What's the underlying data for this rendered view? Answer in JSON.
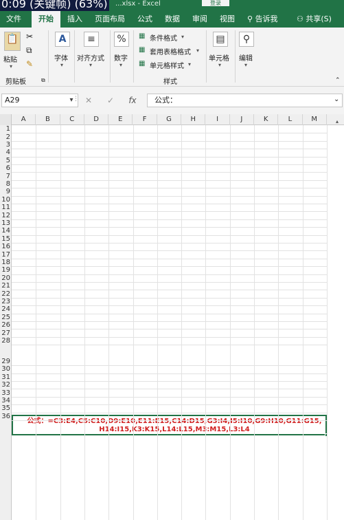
{
  "overlay": {
    "text": "0:09 (关键帧) (63%)"
  },
  "window": {
    "title_fragment": "...xlsx - Excel",
    "title_button": "登录"
  },
  "tabs": [
    {
      "label": "文件",
      "active": false
    },
    {
      "label": "开始",
      "active": true
    },
    {
      "label": "插入",
      "active": false
    },
    {
      "label": "页面布局",
      "active": false
    },
    {
      "label": "公式",
      "active": false
    },
    {
      "label": "数据",
      "active": false
    },
    {
      "label": "审阅",
      "active": false
    },
    {
      "label": "视图",
      "active": false
    }
  ],
  "tell_me": "告诉我",
  "share": "共享(S)",
  "ribbon": {
    "clipboard": {
      "paste": "粘贴",
      "group": "剪贴板"
    },
    "font": "字体",
    "alignment": "对齐方式",
    "number": "数字",
    "styles": {
      "conditional": "条件格式",
      "table": "套用表格格式",
      "cell_styles": "单元格样式",
      "group": "样式"
    },
    "cells": "单元格",
    "editing": "编辑"
  },
  "formula_bar": {
    "name_box": "A29",
    "cancel": "✕",
    "confirm": "✓",
    "fx": "fx",
    "content": "公式："
  },
  "columns": [
    "A",
    "B",
    "C",
    "D",
    "E",
    "F",
    "G",
    "H",
    "I",
    "J",
    "K",
    "L",
    "M"
  ],
  "rows": [
    "1",
    "2",
    "3",
    "4",
    "5",
    "6",
    "7",
    "8",
    "9",
    "10",
    "11",
    "12",
    "13",
    "14",
    "15",
    "16",
    "17",
    "18",
    "19",
    "20",
    "21",
    "22",
    "23",
    "24",
    "25",
    "26",
    "27",
    "28",
    "29",
    "30",
    "31",
    "32",
    "33",
    "34",
    "35",
    "36"
  ],
  "selected_cell": {
    "line1": "公式：=C3:E4,C5:C10,D9:E10,E11:E15,C14:D15,G3:I4,I5:I10,G9:H10,G11:G15,",
    "line2": "H14:I15,K3:K15,L14:L15,M3:M15,L3:L4"
  },
  "colors": {
    "accent": "#217346",
    "formula_text": "#d02020"
  }
}
